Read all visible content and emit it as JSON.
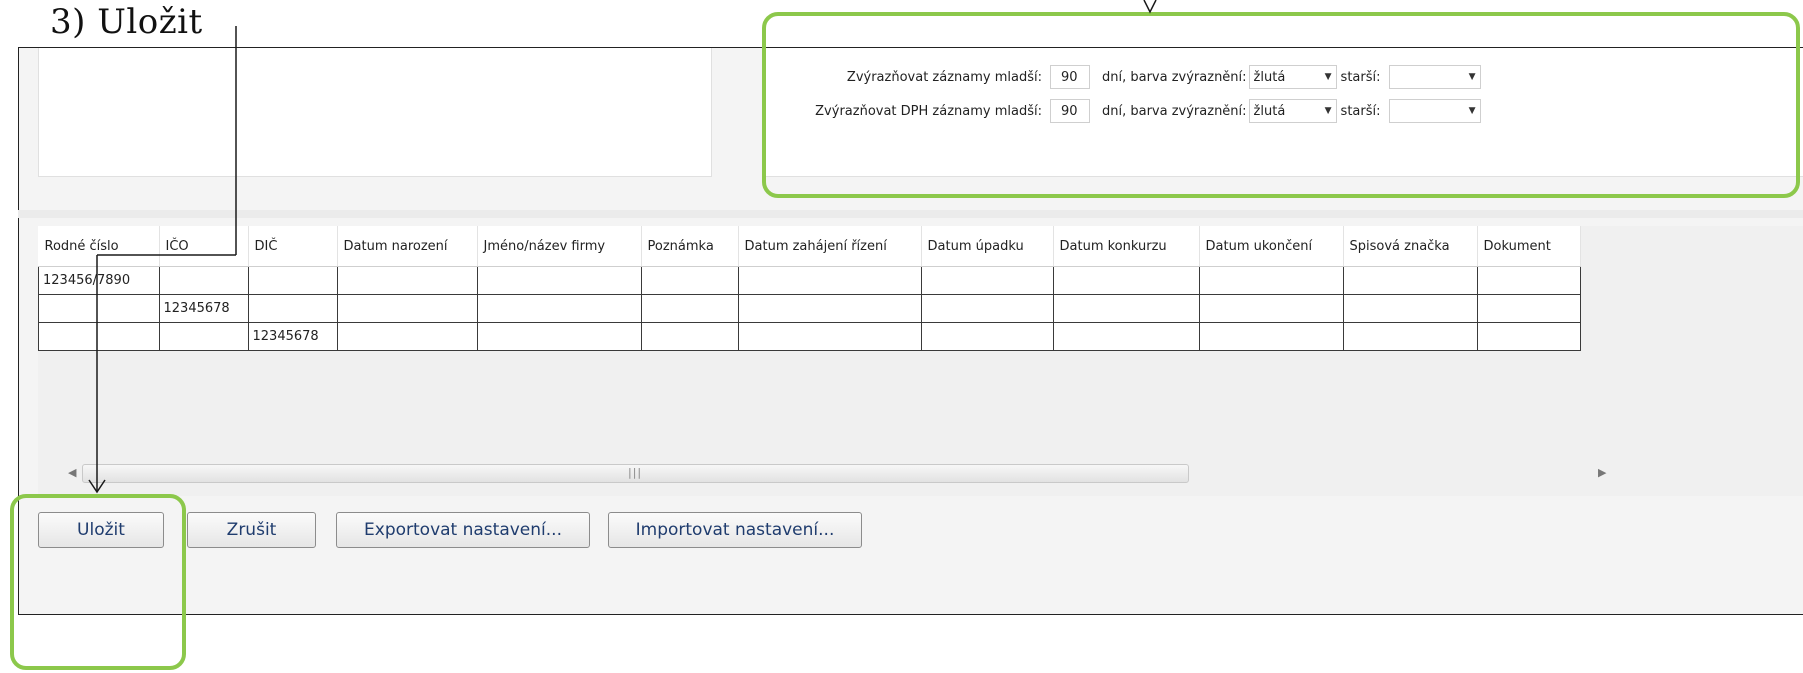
{
  "step_title": "3)  Uložit",
  "highlight": {
    "rows": [
      {
        "label": "Zvýrazňovat záznamy mladší:",
        "days": "90",
        "color_label": "dní, barva zvýraznění:",
        "color_value": "žlutá",
        "older_label": "starší:",
        "older_value": ""
      },
      {
        "label": "Zvýrazňovat DPH záznamy mladší:",
        "days": "90",
        "color_label": "dní, barva zvýraznění:",
        "color_value": "žlutá",
        "older_label": "starší:",
        "older_value": ""
      }
    ]
  },
  "table": {
    "columns": [
      "Rodné číslo",
      "IČO",
      "DIČ",
      "Datum narození",
      "Jméno/název firmy",
      "Poznámka",
      "Datum zahájení řízení",
      "Datum úpadku",
      "Datum konkurzu",
      "Datum ukončení",
      "Spisová značka",
      "Dokument"
    ],
    "rows": [
      [
        "123456/7890",
        "",
        "",
        "",
        "",
        "",
        "",
        "",
        "",
        "",
        "",
        ""
      ],
      [
        "",
        "12345678",
        "",
        "",
        "",
        "",
        "",
        "",
        "",
        "",
        "",
        ""
      ],
      [
        "",
        "",
        "12345678",
        "",
        "",
        "",
        "",
        "",
        "",
        "",
        "",
        ""
      ]
    ]
  },
  "buttons": {
    "save": "Uložit",
    "cancel": "Zrušit",
    "export": "Exportovat nastavení...",
    "import": "Importovat nastavení..."
  },
  "icons": {
    "scroll_left": "scroll-left-arrow-icon",
    "scroll_right": "scroll-right-arrow-icon",
    "dropdown": "chevron-down-icon"
  },
  "colors": {
    "annotation_green": "#8cc84b",
    "button_text": "#1f3c6e"
  }
}
